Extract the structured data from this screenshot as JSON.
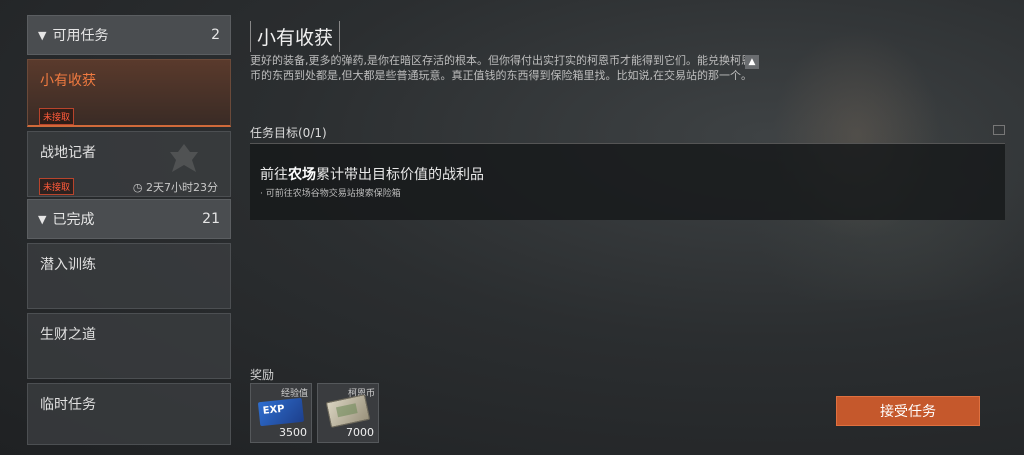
{
  "sidebar": {
    "available": {
      "label": "可用任务",
      "count": "2"
    },
    "quests": [
      {
        "name": "小有收获",
        "badge": "未接取"
      },
      {
        "name": "战地记者",
        "badge": "未接取",
        "timer": "2天7小时23分"
      }
    ],
    "completed": {
      "label": "已完成",
      "count": "21"
    },
    "completed_quests": [
      {
        "name": "潜入训练"
      },
      {
        "name": "生财之道"
      },
      {
        "name": "临时任务"
      }
    ]
  },
  "quest": {
    "title": "小有收获",
    "description": "更好的装备,更多的弹药,是你在暗区存活的根本。但你得付出实打实的柯恩币才能得到它们。能兑换柯恩币的东西到处都是,但大都是些普通玩意。真正值钱的东西得到保险箱里找。比如说,在交易站的那一个。",
    "objective_label": "任务目标(0/1)",
    "objective_prefix": "前往",
    "objective_location": "农场",
    "objective_suffix": "累计带出目标价值的战利品",
    "objective_hint": "· 可前往农场谷物交易站搜索保险箱"
  },
  "rewards": {
    "label": "奖励",
    "items": [
      {
        "name": "经验值",
        "value": "3500",
        "icon_text": "EXP"
      },
      {
        "name": "柯恩币",
        "value": "7000"
      }
    ]
  },
  "actions": {
    "accept": "接受任务"
  },
  "colors": {
    "accent": "#c5582c",
    "active_text": "#f07a40",
    "badge": "#ff5a3a"
  }
}
